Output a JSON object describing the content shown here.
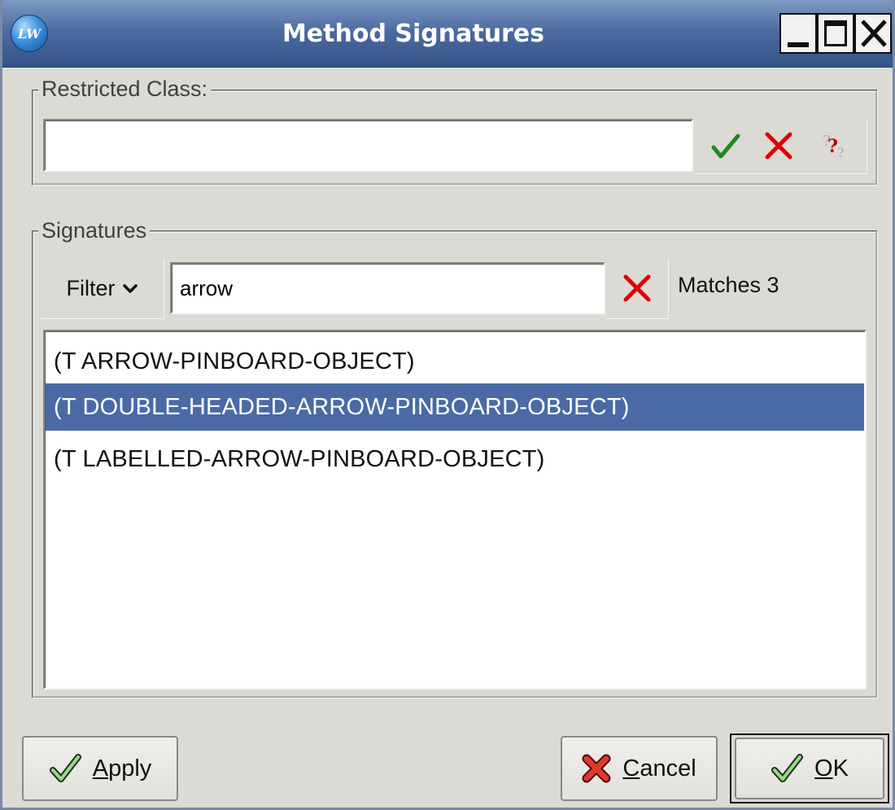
{
  "window": {
    "title": "Method Signatures",
    "app_icon_text": "LW"
  },
  "restricted_class": {
    "label": "Restricted Class:",
    "value": "",
    "icons": [
      "confirm-check-icon",
      "clear-x-icon",
      "help-question-icon"
    ]
  },
  "signatures": {
    "label": "Signatures",
    "filter_label": "Filter",
    "filter_value": "arrow",
    "matches_text": "Matches 3",
    "items": [
      {
        "label": "(T ARROW-PINBOARD-OBJECT)",
        "selected": false
      },
      {
        "label": "(T DOUBLE-HEADED-ARROW-PINBOARD-OBJECT)",
        "selected": true
      },
      {
        "label": "(T LABELLED-ARROW-PINBOARD-OBJECT)",
        "selected": false
      }
    ]
  },
  "buttons": {
    "apply_mnemonic": "A",
    "apply_rest": "pply",
    "cancel_mnemonic": "C",
    "cancel_rest": "ancel",
    "ok_mnemonic": "O",
    "ok_rest": "K"
  },
  "colors": {
    "titlebar": "#4a6aa0",
    "selection": "#4a6aa6",
    "check_green": "#1f8a1f",
    "x_red": "#e00000"
  }
}
